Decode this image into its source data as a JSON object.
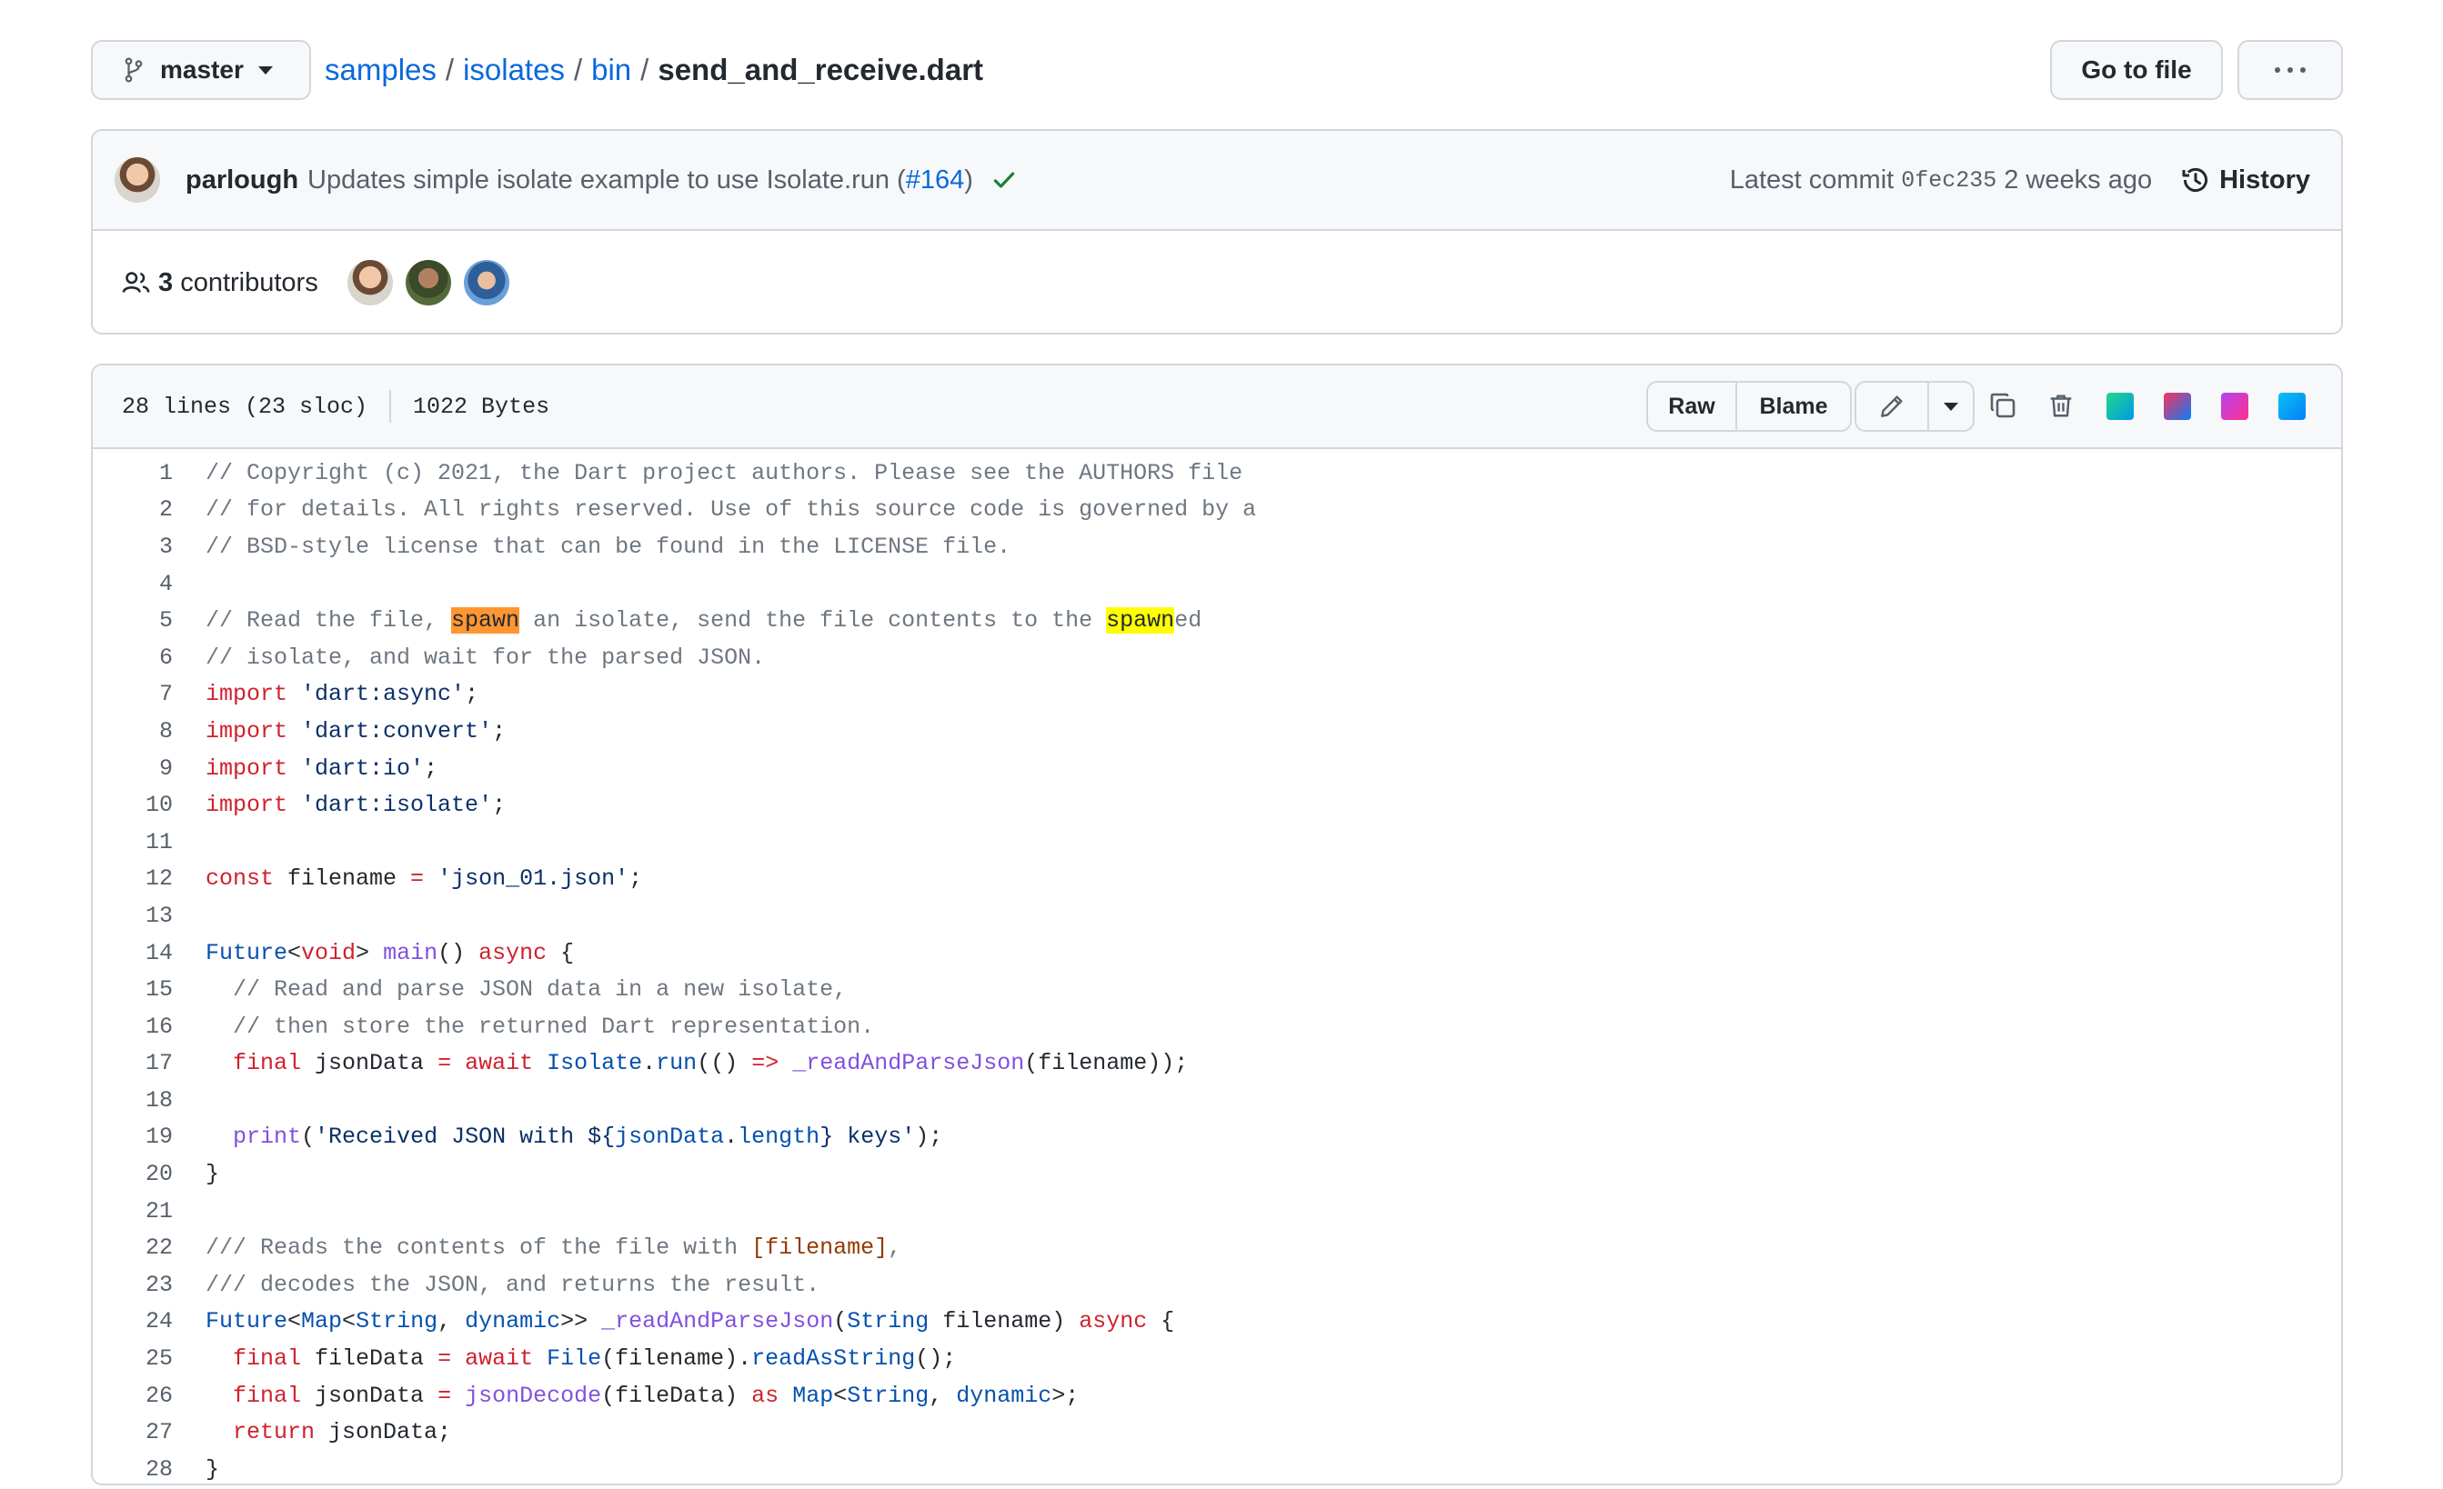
{
  "branch": {
    "name": "master"
  },
  "breadcrumb": {
    "repo": "samples",
    "dir1": "isolates",
    "dir2": "bin",
    "file": "send_and_receive.dart",
    "sep": "/"
  },
  "actions": {
    "go_to_file": "Go to file"
  },
  "commit": {
    "author": "parlough",
    "message": "Updates simple isolate example to use Isolate.run (",
    "pr": "#164",
    "message_end": ")",
    "latest_label": "Latest commit",
    "sha": "0fec235",
    "when": "2 weeks ago",
    "history_label": "History"
  },
  "contributors": {
    "count": "3",
    "label": "contributors"
  },
  "file_info": {
    "lines": "28 lines (23 sloc)",
    "size": "1022 Bytes"
  },
  "toolbar": {
    "raw": "Raw",
    "blame": "Blame"
  },
  "colors": {
    "link": "#0969da",
    "keyword": "#cf222e",
    "string": "#0a3069",
    "type": "#0550ae",
    "function": "#8250df",
    "comment": "#6e7781",
    "highlight_active": "#ff9632",
    "highlight_match": "#ffff00",
    "success": "#1a7f37"
  },
  "code": {
    "line_numbers": [
      "1",
      "2",
      "3",
      "4",
      "5",
      "6",
      "7",
      "8",
      "9",
      "10",
      "11",
      "12",
      "13",
      "14",
      "15",
      "16",
      "17",
      "18",
      "19",
      "20",
      "21",
      "22",
      "23",
      "24",
      "25",
      "26",
      "27",
      "28"
    ],
    "l1": "// Copyright (c) 2021, the Dart project authors. Please see the AUTHORS file",
    "l2": "// for details. All rights reserved. Use of this source code is governed by a",
    "l3": "// BSD-style license that can be found in the LICENSE file.",
    "l5a": "// Read the file, ",
    "l5b": "spawn",
    "l5c": " an isolate, send the file contents to the ",
    "l5d": "spawn",
    "l5e": "ed",
    "l6": "// isolate, and wait for the parsed JSON.",
    "import_kw": "import",
    "semi": ";",
    "l7s": "'dart:async'",
    "l8s": "'dart:convert'",
    "l9s": "'dart:io'",
    "l10s": "'dart:isolate'",
    "const_kw": "const",
    "l12a": " filename ",
    "eq": "=",
    "l12s": "'json_01.json'",
    "future": "Future",
    "lt": "<",
    "gt": ">",
    "void_kw": "void",
    "main_fn": "main",
    "l14a": "() ",
    "async_kw": "async",
    "l14b": " {",
    "l15": "  // Read and parse JSON data in a new isolate,",
    "l16": "  // then store the returned Dart representation.",
    "final_kw": "final",
    "await_kw": "await",
    "l17a": " jsonData ",
    "isolate_t": "Isolate",
    "dot": ".",
    "run_fn": "run",
    "l17b": "(() ",
    "arrow": "=>",
    "parse_fn": "_readAndParseJson",
    "l17c": "(filename));",
    "print_fn": "print",
    "l19a": "(",
    "l19s1": "'Received JSON with ",
    "l19i1": "${",
    "l19v": "jsonData",
    "l19len": "length",
    "l19i2": "}",
    "l19s2": " keys'",
    "l19b": ");",
    "close": "}",
    "l22a": "/// Reads the contents of the file with ",
    "l22b": "[filename]",
    "l22c": ",",
    "l23": "/// decodes the JSON, and returns the result.",
    "map_t": "Map",
    "string_t": "String",
    "dynamic_t": "dynamic",
    "comma": ", ",
    "gtgt": ">>",
    "l24a": "(",
    "l24b": " filename) ",
    "l25a": " fileData ",
    "file_t": "File",
    "l25b": "(filename).",
    "readas_fn": "readAsString",
    "l25c": "();",
    "l26a": " jsonData ",
    "decode_fn": "jsonDecode",
    "l26b": "(fileData) ",
    "as_kw": "as",
    "l26c": ">;",
    "return_kw": "return",
    "l27": " jsonData;"
  }
}
